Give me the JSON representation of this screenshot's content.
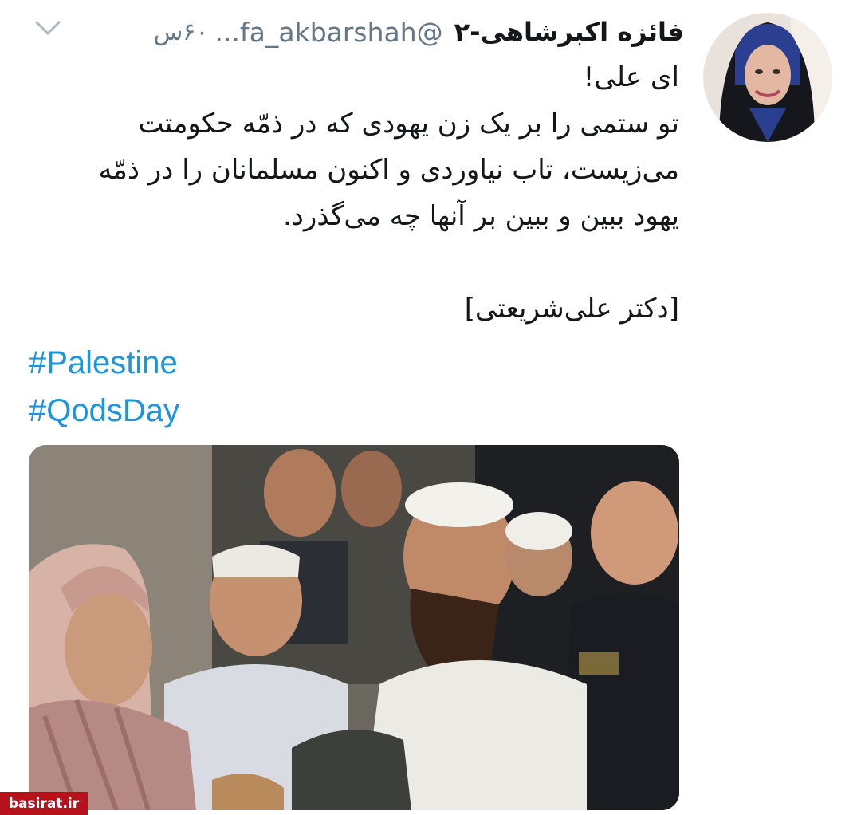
{
  "tweet": {
    "author_name": "فائزه اکبرشاهی-۲",
    "handle": "@fa_akbarshah...",
    "time": "۶۰س",
    "text_lines": [
      "ای علی!",
      "تو ستمی را بر یک زن یهودی که در ذمّه حکومتت",
      "می‌زیست، تاب نیاوردی و اکنون مسلمانان را در ذمّه",
      "یهود ببین و ببین بر آنها چه می‌گذرد.",
      "",
      "[دکتر علی‌شریعتی]"
    ],
    "hashtags": [
      "#Palestine",
      "#QodsDay"
    ]
  },
  "icons": {
    "more": "chevron-down-icon",
    "avatar": "avatar-photo"
  },
  "watermark": "basirat.ir",
  "colors": {
    "link": "#1b95e0",
    "text": "#14171a",
    "muted": "#657786",
    "watermark_bg": "#b5121b"
  }
}
